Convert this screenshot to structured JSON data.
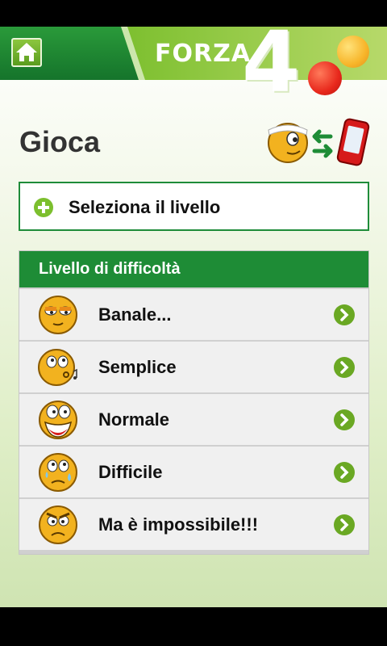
{
  "header": {
    "logo_word": "FORZA",
    "logo_number": "4",
    "home_icon": "home-icon"
  },
  "page": {
    "title": "Gioca",
    "mode_icon": "player-vs-phone-icon"
  },
  "select_level": {
    "label": "Seleziona il livello",
    "icon": "plus-circle-icon"
  },
  "difficulty": {
    "header": "Livello di difficoltà",
    "levels": [
      {
        "label": "Banale...",
        "icon": "bored-face-icon"
      },
      {
        "label": "Semplice",
        "icon": "whistling-face-icon"
      },
      {
        "label": "Normale",
        "icon": "laughing-face-icon"
      },
      {
        "label": "Difficile",
        "icon": "sweating-face-icon"
      },
      {
        "label": "Ma è impossibile!!!",
        "icon": "angry-face-icon"
      }
    ]
  },
  "colors": {
    "brand_green": "#1e8c36",
    "light_green": "#8cc63f",
    "row_bg": "#f0f0f0"
  }
}
